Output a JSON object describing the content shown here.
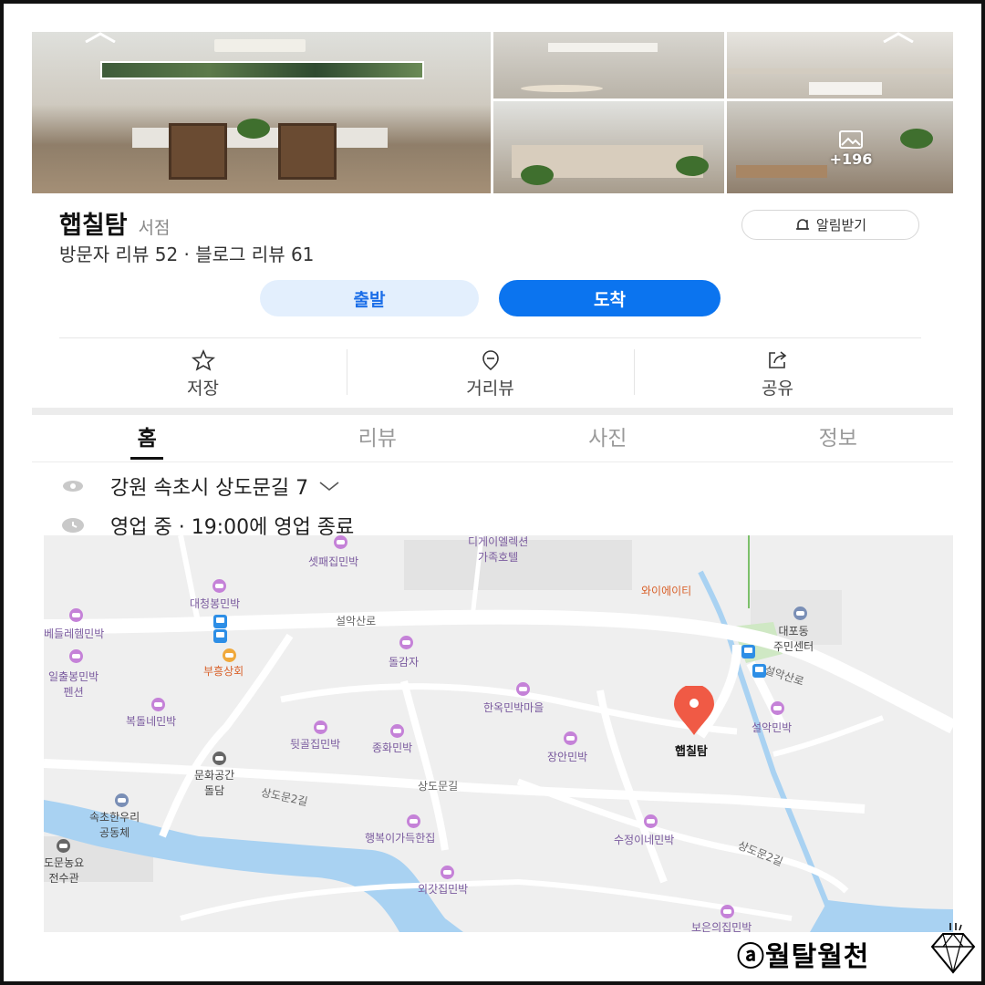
{
  "place": {
    "name": "햅칠탐",
    "category": "서점",
    "reviews": "방문자 리뷰 52 · 블로그 리뷰 61",
    "photo_count": "+196",
    "alert_label": "알림받기"
  },
  "route": {
    "start_label": "출발",
    "arrive_label": "도착"
  },
  "actions": {
    "save": "저장",
    "street_view": "거리뷰",
    "share": "공유"
  },
  "tabs": [
    "홈",
    "리뷰",
    "사진",
    "정보"
  ],
  "info": {
    "address": "강원 속초시 상도문길 7",
    "hours": "영업 중 · 19:00에 영업 종료"
  },
  "map": {
    "labels": {
      "hotel": "디게이엘렉션\n가족호텔",
      "sepae": "셋패집민박",
      "daecheong": "대청봉민박",
      "hwailhalla": "베들레헴민박",
      "bus_a": "",
      "seorak_road_1": "설악산로",
      "buheung": "부흥상회",
      "dolgamja": "돌감자",
      "ilchul": "일출봉민박\n펜션",
      "waiei": "와이에이티",
      "daepo": "대포동\n주민센터",
      "seorak_road_2": "설악산로",
      "hanok": "한옥민박마을",
      "seorak_minbak": "설악민박",
      "bokdol": "복돌네민박",
      "dwitgol": "뒷골집민박",
      "jonghwa": "종화민박",
      "jangan": "장안민박",
      "pin_name": "햅칠탐",
      "munhwa": "문화공간\n돌담",
      "sangdomun": "상도문길",
      "sangdomun2": "상도문2길",
      "sokcho": "속초한우리\n공동체",
      "haengbok": "행복이가득한집",
      "sujeong": "수정이네민박",
      "sangdomun2b": "상도문2길",
      "nongyo": "도문농요\n전수관",
      "oegat": "외갓집민박",
      "boeun": "보은의집민박"
    }
  },
  "watermark": "ⓐ월탈월천"
}
